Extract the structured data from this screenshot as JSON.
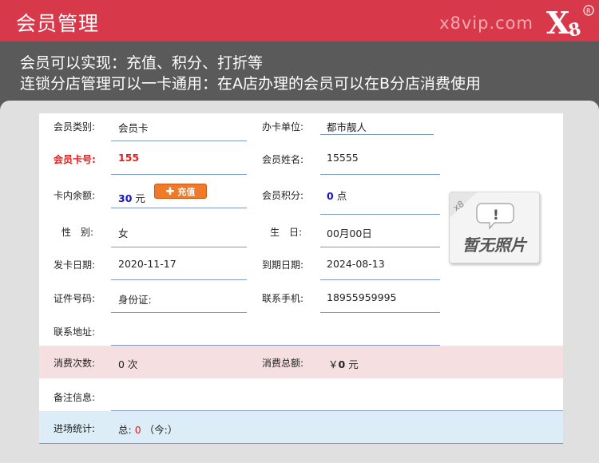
{
  "header": {
    "title": "会员管理",
    "site": "x8vip.com",
    "logo_text": "X8"
  },
  "intro": {
    "line1": "会员可以实现：充值、积分、打折等",
    "line2": "连锁分店管理可以一卡通用：在A店办理的会员可以在B分店消费使用"
  },
  "form": {
    "card_type_label": "会员类别:",
    "card_type_value": "会员卡",
    "issuer_label": "办卡单位:",
    "issuer_value": "都市靓人",
    "card_no_label": "会员卡号:",
    "card_no_value": "155",
    "member_name_label": "会员姓名:",
    "member_name_value": "15555",
    "balance_label": "卡内余额:",
    "balance_value": "30",
    "balance_unit": "元",
    "recharge_label": "充值",
    "points_label": "会员积分:",
    "points_value": "0",
    "points_unit": "点",
    "gender_label": "性　别:",
    "gender_value": "女",
    "birthday_label": "生　日:",
    "birthday_value": "00月00日",
    "issue_date_label": "发卡日期:",
    "issue_date_value": "2020-11-17",
    "expire_date_label": "到期日期:",
    "expire_date_value": "2024-08-13",
    "id_label": "证件号码:",
    "id_value": "身份证:",
    "phone_label": "联系手机:",
    "phone_value": "18955959995",
    "address_label": "联系地址:",
    "address_value": "",
    "consume_count_label": "消费次数:",
    "consume_count_value": "0 次",
    "consume_total_label": "消费总额:",
    "consume_total_prefix": "￥",
    "consume_total_value": "0",
    "consume_total_unit": "元",
    "remark_label": "备注信息:",
    "remark_value": "",
    "visit_label": "进场统计:",
    "visit_prefix": "总:",
    "visit_value": "0",
    "visit_suffix": "（今:）"
  },
  "photo": {
    "text": "暂无照片",
    "badge": "x8",
    "alert": "!"
  },
  "colors": {
    "header": "#d8394a",
    "intro_bg": "#5a5a5a",
    "consume_row": "#f5dfe1",
    "visit_row": "#dcedf8"
  }
}
